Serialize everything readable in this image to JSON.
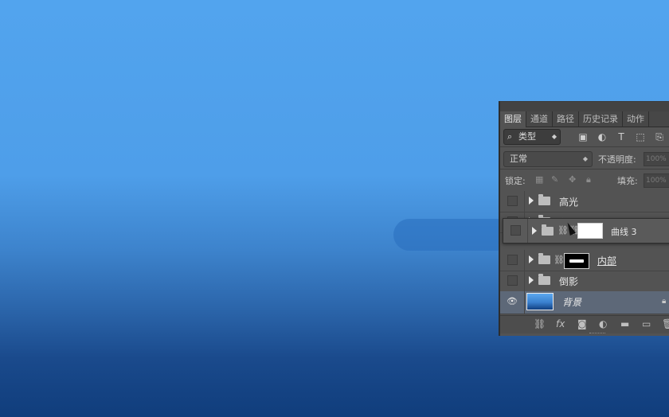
{
  "panel": {
    "tabs": [
      {
        "label": "图层",
        "active": true
      },
      {
        "label": "通道",
        "active": false
      },
      {
        "label": "路径",
        "active": false
      },
      {
        "label": "历史记录",
        "active": false
      },
      {
        "label": "动作",
        "active": false
      }
    ],
    "filter": {
      "kind_label": "类型",
      "icons": [
        "image-filter-icon",
        "adjustment-filter-icon",
        "type-filter-icon",
        "shape-filter-icon",
        "smart-object-filter-icon"
      ]
    },
    "blend_mode": "正常",
    "opacity_label": "不透明度:",
    "opacity_value": "100%",
    "lock_label": "锁定:",
    "fill_label": "填充:",
    "fill_value": "100%",
    "layers": [
      {
        "name": "高光",
        "type": "group"
      },
      {
        "name": "瓶子",
        "type": "group"
      },
      {
        "name": "内部",
        "type": "group-with-mask"
      },
      {
        "name": "倒影",
        "type": "group"
      },
      {
        "name": "背景",
        "type": "background"
      }
    ],
    "dragging_layer": {
      "name": "曲线 3"
    },
    "bottom_icons": [
      "link-layers-icon",
      "fx-icon",
      "add-mask-icon",
      "adjustment-layer-icon",
      "new-group-icon",
      "new-layer-icon",
      "delete-icon"
    ]
  },
  "colors": {
    "canvas_top": "#52a4ee",
    "canvas_bottom": "#103d7c",
    "panel_bg": "#535353",
    "selected_row": "#5d6878"
  }
}
